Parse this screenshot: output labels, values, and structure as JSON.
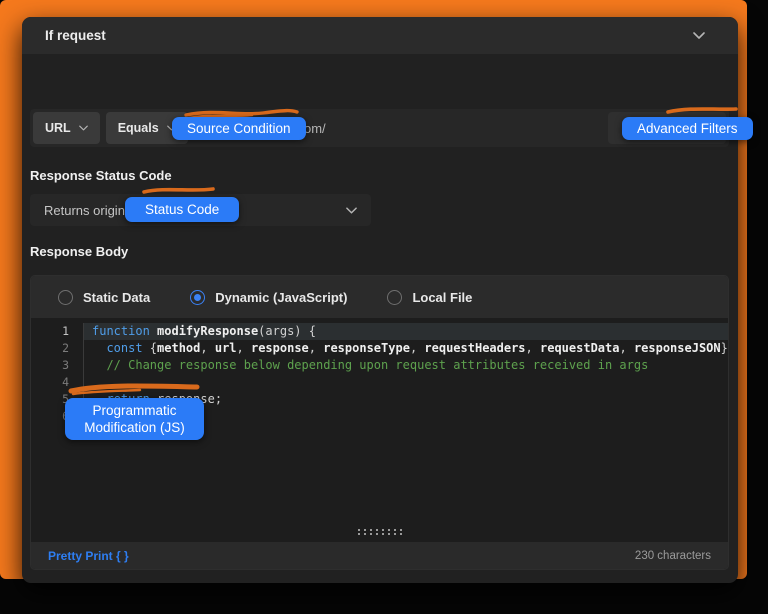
{
  "accent": {
    "frame_orange": "#f5791d",
    "annotation_blue": "#2b7bf7",
    "scribble_orange": "#d96a1c"
  },
  "header": {
    "title": "If request"
  },
  "condition_row": {
    "key_selector": {
      "value": "URL"
    },
    "operator_selector": {
      "value": "Equals"
    },
    "url_input": {
      "value": "https://example.com/"
    }
  },
  "status_code_section": {
    "label": "Response Status Code",
    "dropdown": {
      "value": "Returns original code if left empty"
    }
  },
  "response_body_section": {
    "label": "Response Body",
    "radios": [
      {
        "label": "Static Data",
        "selected": false
      },
      {
        "label": "Dynamic (JavaScript)",
        "selected": true
      },
      {
        "label": "Local File",
        "selected": false
      }
    ],
    "editor": {
      "lines": [
        {
          "active": true,
          "tokens": [
            {
              "c": "kw",
              "t": "function"
            },
            {
              "c": "def",
              "t": " modifyResponse"
            },
            {
              "c": "pln",
              "t": "(args) {"
            }
          ]
        },
        {
          "active": false,
          "tokens": [
            {
              "c": "kw",
              "t": "  const"
            },
            {
              "c": "pln",
              "t": " {"
            },
            {
              "c": "def",
              "t": "method"
            },
            {
              "c": "pln",
              "t": ", "
            },
            {
              "c": "def",
              "t": "url"
            },
            {
              "c": "pln",
              "t": ", "
            },
            {
              "c": "def",
              "t": "response"
            },
            {
              "c": "pln",
              "t": ", "
            },
            {
              "c": "def",
              "t": "responseType"
            },
            {
              "c": "pln",
              "t": ", "
            },
            {
              "c": "def",
              "t": "requestHeaders"
            },
            {
              "c": "pln",
              "t": ", "
            },
            {
              "c": "def",
              "t": "requestData"
            },
            {
              "c": "pln",
              "t": ", "
            },
            {
              "c": "def",
              "t": "responseJSON"
            },
            {
              "c": "pln",
              "t": "} = args;"
            }
          ]
        },
        {
          "active": false,
          "tokens": [
            {
              "c": "cmt",
              "t": "  // Change response below depending upon request attributes received in args"
            }
          ]
        },
        {
          "active": false,
          "tokens": []
        },
        {
          "active": false,
          "tokens": [
            {
              "c": "kw",
              "t": "  return"
            },
            {
              "c": "pln",
              "t": " response;"
            }
          ]
        },
        {
          "active": false,
          "tokens": [
            {
              "c": "pln",
              "t": "}"
            }
          ]
        }
      ]
    },
    "footer": {
      "pretty_print_label": "Pretty Print { }",
      "char_count": "230 characters"
    }
  },
  "annotations": {
    "source_condition": "Source Condition",
    "advanced_filters": "Advanced Filters",
    "status_code": "Status Code",
    "programmatic": "Programmatic Modification (JS)"
  }
}
